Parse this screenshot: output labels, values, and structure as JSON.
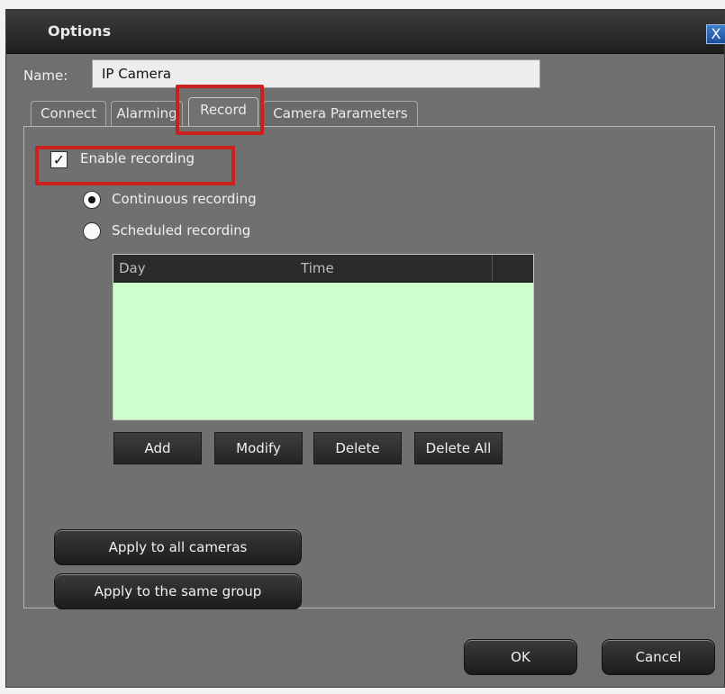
{
  "window": {
    "title": "Options",
    "close_label": "X"
  },
  "name_field": {
    "label": "Name:",
    "value": "IP Camera"
  },
  "tabs": [
    {
      "label": "Connect"
    },
    {
      "label": "Alarming"
    },
    {
      "label": "Record"
    },
    {
      "label": "Camera Parameters"
    }
  ],
  "record": {
    "enable_recording": {
      "label": "Enable recording",
      "checked": true
    },
    "modes": [
      {
        "label": "Continuous recording",
        "selected": true
      },
      {
        "label": "Scheduled recording",
        "selected": false
      }
    ],
    "schedule_table": {
      "columns": [
        "Day",
        "Time"
      ],
      "rows": []
    },
    "schedule_buttons": {
      "add": "Add",
      "modify": "Modify",
      "delete": "Delete",
      "delete_all": "Delete All"
    },
    "apply_all": "Apply to all cameras",
    "apply_group": "Apply to the same group"
  },
  "dialog_buttons": {
    "ok": "OK",
    "cancel": "Cancel"
  },
  "colors": {
    "highlight": "#cc1f1f",
    "table_background": "#ccffcc"
  }
}
